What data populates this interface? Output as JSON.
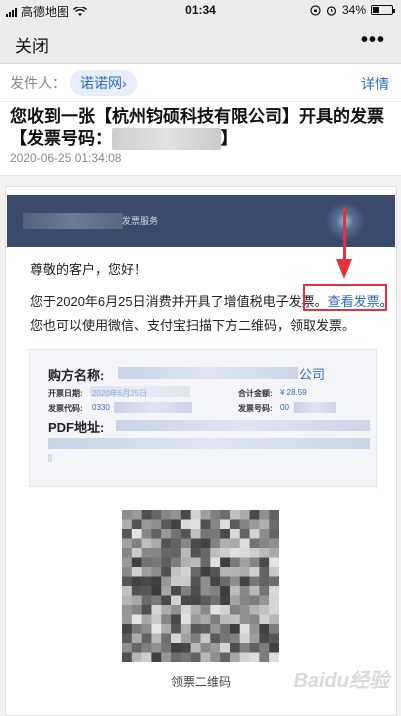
{
  "status_bar": {
    "carrier": "高德地图",
    "time": "01:34",
    "battery_percent": 34,
    "battery_label": "34%"
  },
  "nav": {
    "close_label": "关闭",
    "more_label": "•••"
  },
  "mail": {
    "sender_label": "发件人：",
    "sender_name": "诺诺网",
    "detail_label": "详情",
    "subject_part1": "您收到一张【杭州钧硕科技有限公司】开具的发票【发票号码：",
    "subject_part2": "】",
    "date": "2020-06-25 01:34:08"
  },
  "content": {
    "banner_text": "发票服务",
    "greeting": "尊敬的客户，您好！",
    "line1_prefix": "您于2020年6月25日消费并开具了增值税电子发票。",
    "view_invoice_link": "查看发票",
    "line1_suffix": "。",
    "line2": "您也可以使用微信、支付宝扫描下方二维码，领取发票。"
  },
  "invoice": {
    "buyer_label": "购方名称:",
    "buyer_tail": "公司",
    "issue_date_label": "开票日期:",
    "issue_date_value": "2020年6月25日",
    "amount_label": "合计金额:",
    "amount_value": "¥ 28.59",
    "invoice_code_label": "发票代码:",
    "invoice_code_value": "0330",
    "invoice_no_label": "发票号码:",
    "invoice_no_value": "00",
    "pdf_label": "PDF地址:"
  },
  "qr": {
    "caption": "领票二维码"
  },
  "watermark": "Baidu经验",
  "colors": {
    "accent_blue": "#2f6bc4",
    "highlight_red": "#e0343a",
    "banner_navy": "#3c4a6b"
  },
  "icons": [
    "signal-icon",
    "wifi-icon",
    "lock-rotation-icon",
    "alarm-icon",
    "battery-icon",
    "more-icon",
    "arrow-down-annotation"
  ]
}
